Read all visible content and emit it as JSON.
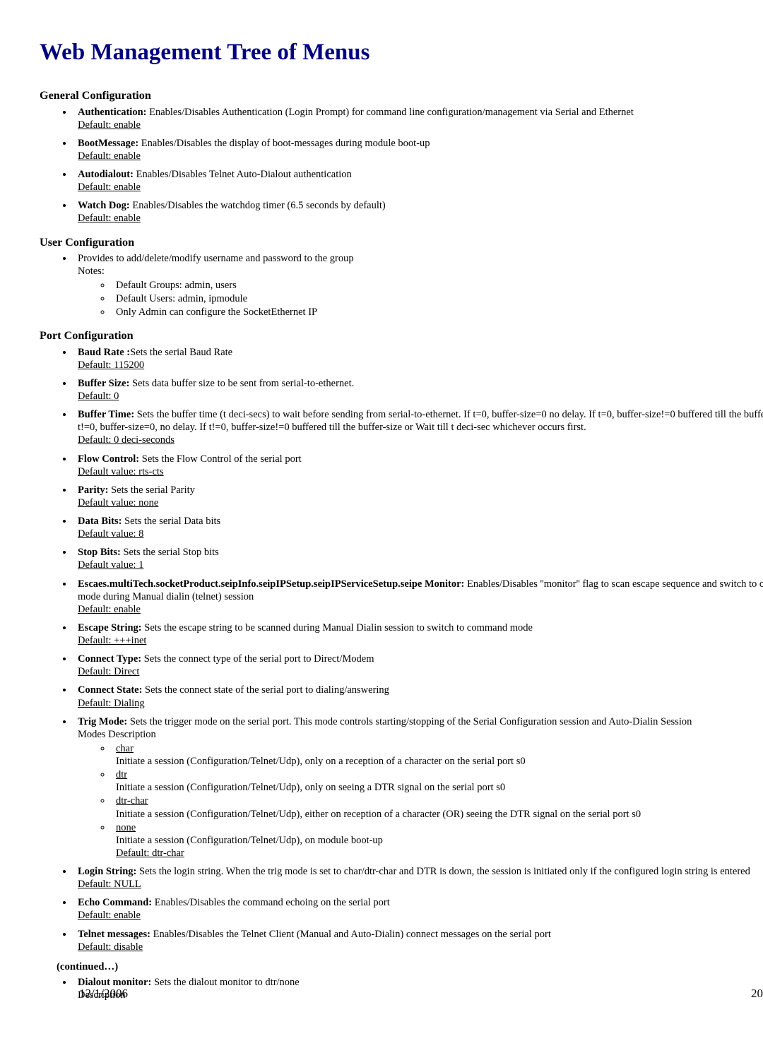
{
  "title": "Web Management Tree of Menus",
  "sections": {
    "general": {
      "heading": "General Configuration",
      "items": [
        {
          "label": "Authentication:",
          "desc": " Enables/Disables Authentication (Login Prompt) for command line configuration/management via Serial and Ethernet",
          "def": "Default: enable"
        },
        {
          "label": "BootMessage:",
          "desc": " Enables/Disables the display of boot-messages during module boot-up",
          "def": "Default: enable"
        },
        {
          "label": "Autodialout:",
          "desc": " Enables/Disables Telnet Auto-Dialout authentication",
          "def": "Default: enable"
        },
        {
          "label": "Watch Dog:",
          "desc": " Enables/Disables the watchdog timer (6.5 seconds by default)",
          "def": "Default: enable"
        }
      ]
    },
    "user": {
      "heading": "User Configuration",
      "item": {
        "desc": "Provides to add/delete/modify username and password to the group",
        "notes_label": "Notes:",
        "notes": [
          "Default Groups: admin, users",
          "Default Users: admin, ipmodule",
          "Only Admin can configure the SocketEthernet IP"
        ]
      }
    },
    "port": {
      "heading": "Port Configuration",
      "items": [
        {
          "label": "Baud Rate :",
          "desc": "Sets the serial Baud Rate",
          "def": "Default: 115200"
        },
        {
          "label": "Buffer Size:",
          "desc": " Sets data buffer size to be sent from serial-to-ethernet.",
          "def": "Default: 0"
        },
        {
          "label": "Buffer Time:",
          "desc": " Sets the buffer time (t deci-secs) to wait before sending from serial-to-ethernet. If t=0, buffer-size=0 no delay. If t=0, buffer-size!=0 buffered till the buffer-size. If t!=0, buffer-size=0, no delay. If t!=0, buffer-size!=0 buffered till the buffer-size or Wait till t deci-sec whichever occurs first.",
          "def": "Default: 0 deci-seconds"
        },
        {
          "label": "Flow Control:",
          "desc": " Sets the Flow Control of the serial port",
          "def": "Default value: rts-cts"
        },
        {
          "label": "Parity:",
          "desc": " Sets the serial Parity",
          "def": "Default value: none"
        },
        {
          "label": "Data Bits:",
          "desc": " Sets the serial Data bits",
          "def": "Default value: 8"
        },
        {
          "label": "Stop Bits:",
          "desc": " Sets the serial Stop bits",
          "def": "Default value: 1"
        },
        {
          "label": "Escaes.multiTech.socketProduct.seipInfo.seipIPSetup.seipIPServiceSetup.seipe Monitor:",
          "desc": " Enables/Disables ''monitor'' flag to scan escape sequence and switch to command mode during Manual dialin (telnet) session",
          "def": "Default: enable"
        },
        {
          "label": "Escape String:",
          "desc": " Sets the escape string to be scanned during Manual Dialin session to switch to command mode",
          "def": "Default: +++inet"
        },
        {
          "label": "Connect Type:",
          "desc": " Sets the connect type of the serial port to Direct/Modem",
          "def": "Default: Direct"
        },
        {
          "label": "Connect State:",
          "desc": " Sets the connect state of the serial port to dialing/answering",
          "def": "Default: Dialing"
        }
      ],
      "trig": {
        "label": "Trig Mode:",
        "desc": " Sets the trigger mode on the serial port. This mode controls starting/stopping of the Serial Configuration session and Auto-Dialin Session",
        "sub": "Modes Description",
        "modes": [
          {
            "name": "char",
            "desc": "Initiate a session (Configuration/Telnet/Udp), only on a reception of a character on the serial port s0"
          },
          {
            "name": "dtr",
            "desc": "Initiate a session (Configuration/Telnet/Udp), only on seeing a DTR signal on the serial port s0"
          },
          {
            "name": "dtr-char",
            "desc": "Initiate a session (Configuration/Telnet/Udp), either on reception of a character (OR) seeing the DTR signal on the serial port s0"
          },
          {
            "name": "none",
            "desc": "Initiate a session (Configuration/Telnet/Udp), on module boot-up",
            "def": "Default: dtr-char"
          }
        ]
      },
      "after_trig": [
        {
          "label": "Login String:",
          "desc": " Sets the login string. When the trig mode is set to char/dtr-char and DTR is down, the session is initiated only if the configured login string is entered",
          "def": "Default: NULL"
        },
        {
          "label": "Echo Command:",
          "desc": " Enables/Disables the command echoing on the serial port",
          "def": "Default: enable"
        },
        {
          "label": "Telnet messages:",
          "desc": " Enables/Disables the Telnet Client (Manual and Auto-Dialin) connect messages on the serial port",
          "def": "Default: disable"
        }
      ],
      "continued": "(continued…)",
      "cont_item": {
        "label": "Dialout monitor:",
        "desc": " Sets the dialout monitor to dtr/none",
        "sub": "Description"
      }
    }
  },
  "footer": {
    "date": "12/1/2006",
    "page": "20"
  }
}
